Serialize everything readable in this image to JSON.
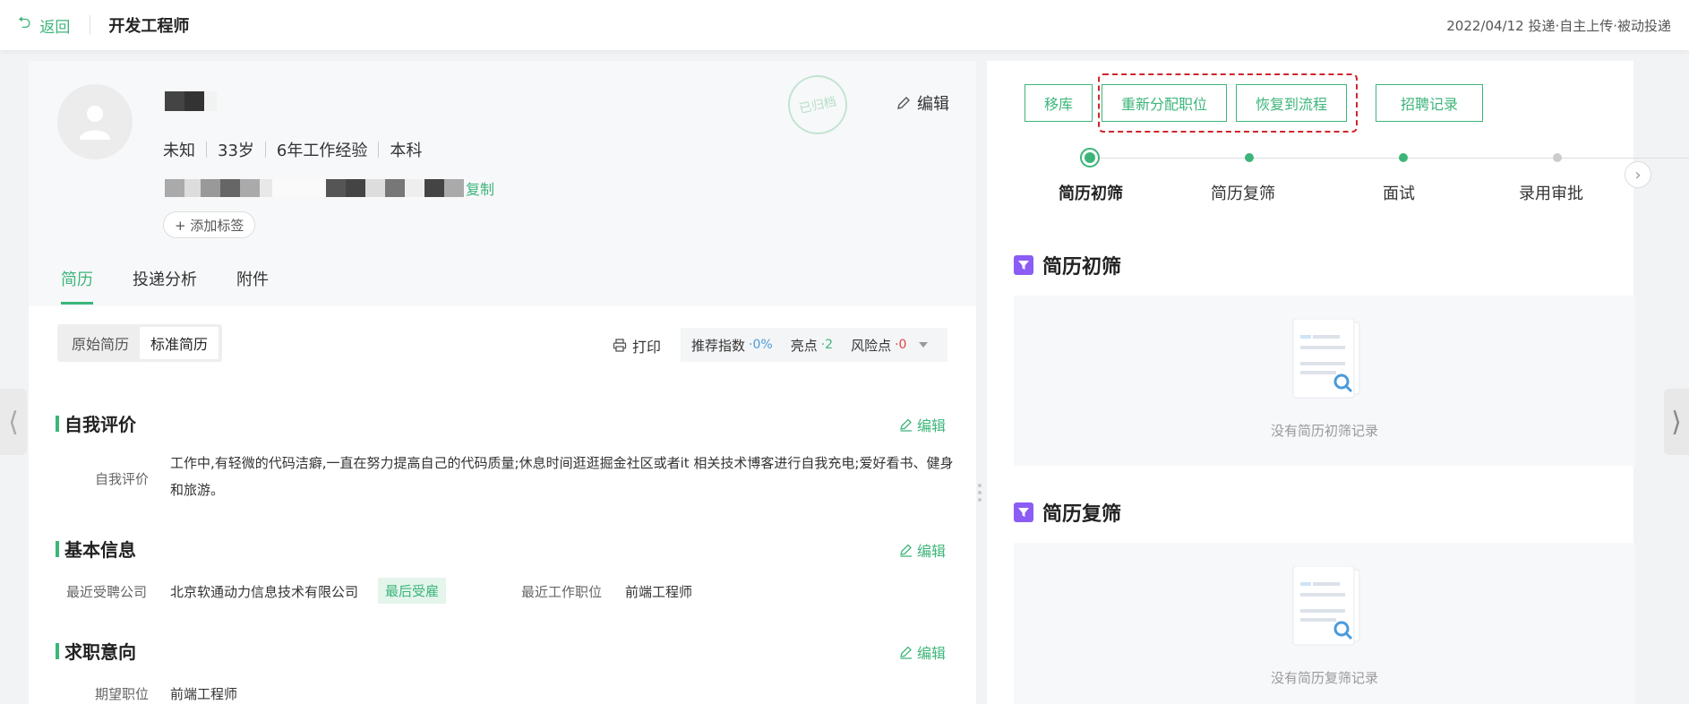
{
  "topbar": {
    "back_label": "返回",
    "job_title": "开发工程师",
    "meta": "2022/04/12 投递·自主上传·被动投递"
  },
  "profile": {
    "gender": "未知",
    "age": "33岁",
    "experience": "6年工作经验",
    "education": "本科",
    "copy_label": "复制",
    "add_tag_label": "+ 添加标签",
    "stamp_text": "已归档",
    "edit_label": "编辑"
  },
  "tabs": [
    {
      "label": "简历",
      "active": true
    },
    {
      "label": "投递分析",
      "active": false
    },
    {
      "label": "附件",
      "active": false
    }
  ],
  "resume_toolbar": {
    "original_label": "原始简历",
    "standard_label": "标准简历",
    "print_label": "打印",
    "recommend_label": "推荐指数",
    "recommend_value": "·0%",
    "highlight_label": "亮点",
    "highlight_value": "·2",
    "risk_label": "风险点",
    "risk_value": "·0"
  },
  "sections": {
    "self_eval": {
      "title": "自我评价",
      "edit_label": "编辑",
      "field_label": "自我评价",
      "text": "工作中,有轻微的代码洁癖,一直在努力提高自己的代码质量;休息时间逛逛掘金社区或者it  相关技术博客进行自我充电;爱好看书、健身和旅游。"
    },
    "basic_info": {
      "title": "基本信息",
      "edit_label": "编辑",
      "company_label": "最近受聘公司",
      "company_value": "北京软通动力信息技术有限公司",
      "company_badge": "最后受雇",
      "position_label": "最近工作职位",
      "position_value": "前端工程师"
    },
    "job_intent": {
      "title": "求职意向",
      "edit_label": "编辑",
      "expected_label": "期望职位",
      "expected_value": "前端工程师"
    }
  },
  "actions": [
    {
      "label": "移库"
    },
    {
      "label": "重新分配职位"
    },
    {
      "label": "恢复到流程"
    },
    {
      "label": "招聘记录"
    }
  ],
  "steps": [
    {
      "label": "简历初筛",
      "state": "current"
    },
    {
      "label": "简历复筛",
      "state": "done"
    },
    {
      "label": "面试",
      "state": "done"
    },
    {
      "label": "录用审批",
      "state": "pending"
    }
  ],
  "right_sections": [
    {
      "title": "简历初筛",
      "empty_text": "没有简历初筛记录"
    },
    {
      "title": "简历复筛",
      "empty_text": "没有简历复筛记录"
    }
  ],
  "colors": {
    "accent": "#3db57a",
    "highlight_dash": "#d0242b",
    "filter_icon": "#8b5cf6",
    "recommend": "#4a9bdc",
    "risk": "#e04545"
  }
}
